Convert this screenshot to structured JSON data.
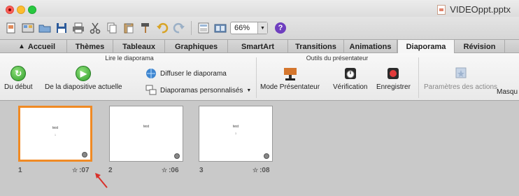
{
  "window": {
    "title": "VIDEOppt.pptx"
  },
  "toolbar": {
    "zoom_value": "66%",
    "help_glyph": "?"
  },
  "tabs": [
    {
      "label": "Accueil",
      "icon": "home-icon"
    },
    {
      "label": "Thèmes"
    },
    {
      "label": "Tableaux"
    },
    {
      "label": "Graphiques"
    },
    {
      "label": "SmartArt"
    },
    {
      "label": "Transitions"
    },
    {
      "label": "Animations"
    },
    {
      "label": "Diaporama",
      "active": true
    },
    {
      "label": "Révision"
    }
  ],
  "ribbon": {
    "group1": {
      "label": "Lire le diaporama",
      "from_start": "Du début",
      "from_current": "De la diapositive actuelle",
      "broadcast": "Diffuser le diaporama",
      "custom_shows": "Diaporamas personnalisés"
    },
    "group2": {
      "label": "Outils du présentateur",
      "presenter_mode": "Mode Présentateur",
      "rehearse": "Vérification",
      "record": "Enregistrer"
    },
    "group3": {
      "action_settings": "Paramètres des actions",
      "hide": "Masqu"
    }
  },
  "slides": [
    {
      "number": "1",
      "title": "test",
      "subtitle": "1",
      "time": ":07",
      "selected": true
    },
    {
      "number": "2",
      "title": "test",
      "subtitle": "",
      "time": ":06",
      "selected": false
    },
    {
      "number": "3",
      "title": "test",
      "subtitle": "3",
      "time": ":08",
      "selected": false
    }
  ],
  "colors": {
    "selection": "#f08a24",
    "annotation_arrow": "#d9302a"
  }
}
